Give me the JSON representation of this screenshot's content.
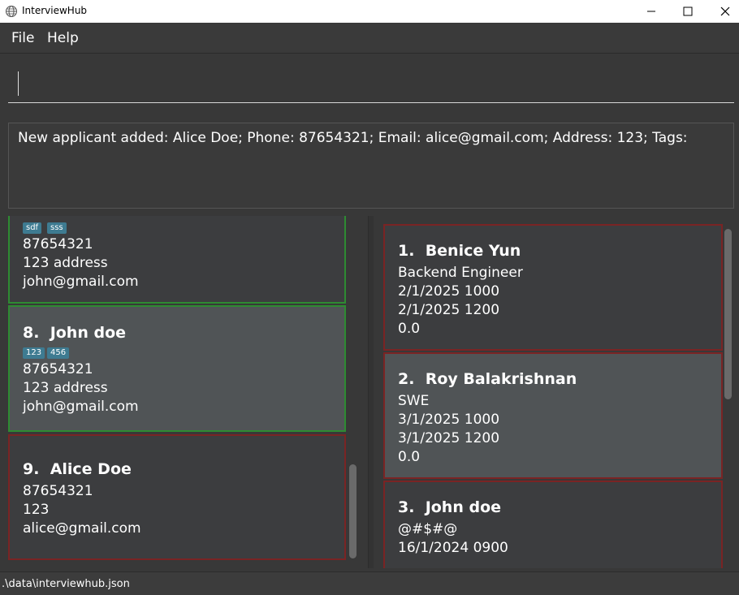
{
  "window": {
    "title": "InterviewHub",
    "controls": [
      "minimize",
      "maximize",
      "close"
    ]
  },
  "menu": {
    "items": [
      {
        "label": "File"
      },
      {
        "label": "Help"
      }
    ]
  },
  "command": {
    "value": "",
    "placeholder": ""
  },
  "result": {
    "message": "New applicant added: Alice Doe; Phone: 87654321; Email: alice@gmail.com; Address: 123; Tags:"
  },
  "applicants": [
    {
      "index": "",
      "name": "",
      "tags": [
        "sdf",
        "sss"
      ],
      "phone": "87654321",
      "address": "123 address",
      "email": "john@gmail.com",
      "status_color": "#2e8b32",
      "selected": false
    },
    {
      "index": "8.",
      "name": "John doe",
      "tags": [
        "123",
        "456"
      ],
      "phone": "87654321",
      "address": "123 address",
      "email": "john@gmail.com",
      "status_color": "#2e8b32",
      "selected": true
    },
    {
      "index": "9.",
      "name": "Alice Doe",
      "tags": [],
      "phone": "87654321",
      "address": "123",
      "email": "alice@gmail.com",
      "status_color": "#7a2424",
      "selected": false
    }
  ],
  "interviews": [
    {
      "index": "1.",
      "name": "Benice Yun",
      "role": "Backend Engineer",
      "start": "2/1/2025 1000",
      "end": "2/1/2025 1200",
      "score": "0.0",
      "selected": false
    },
    {
      "index": "2.",
      "name": "Roy Balakrishnan",
      "role": "SWE",
      "start": "3/1/2025 1000",
      "end": "3/1/2025 1200",
      "score": "0.0",
      "selected": true
    },
    {
      "index": "3.",
      "name": "John doe",
      "role": "@#$#@",
      "start": "16/1/2024 0900",
      "end": "",
      "score": "",
      "selected": false
    }
  ],
  "status": {
    "file_path": ".\\data\\interviewhub.json"
  },
  "colors": {
    "accepted_border": "#2e8b32",
    "rejected_border": "#7a2424",
    "tag_bg": "#3e7b91",
    "background": "#383838"
  }
}
